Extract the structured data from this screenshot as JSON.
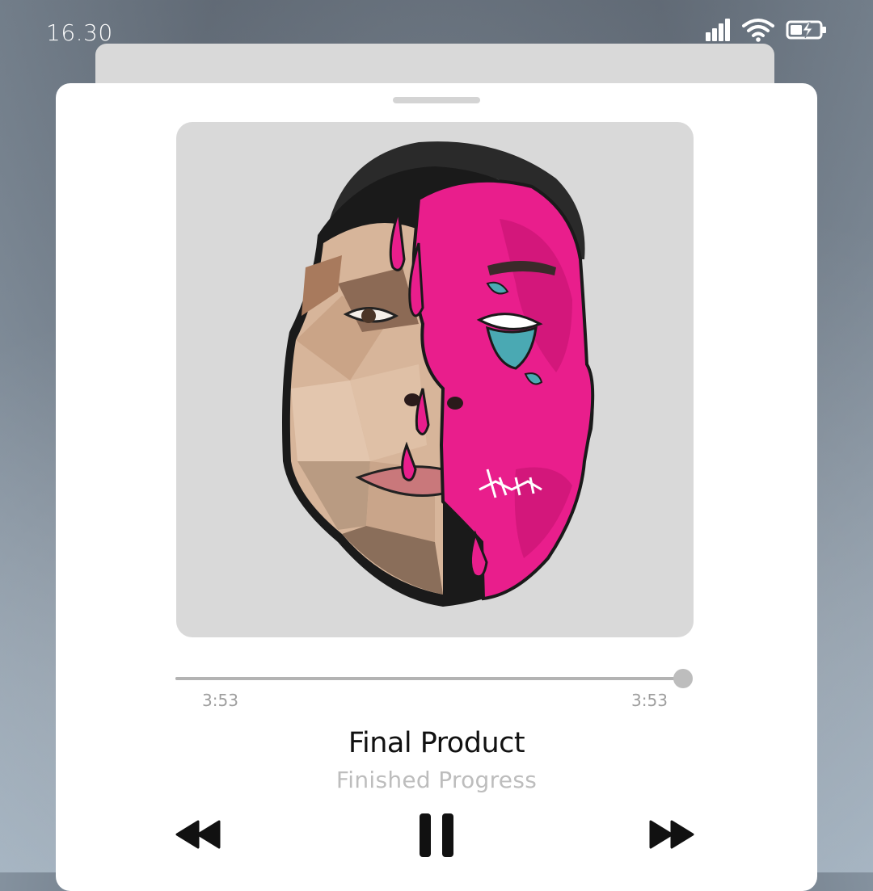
{
  "status_bar": {
    "time": "16.30",
    "icons": [
      "signal-bars-icon",
      "wifi-icon",
      "battery-charging-icon"
    ]
  },
  "player": {
    "album_art": "stylized face portrait with dripping pink paint",
    "progress": {
      "elapsed": "3:53",
      "total": "3:53",
      "fraction": 1.0
    },
    "title": "Final Product",
    "artist": "Finished Progress",
    "controls": [
      "rewind-icon",
      "pause-icon",
      "fast-forward-icon"
    ]
  },
  "colors": {
    "accent_pink": "#e91e8c",
    "skin": "#d9b8a0",
    "card": "#ffffff",
    "art_bg": "#d9d9d9",
    "subtitle": "#bdbdbd"
  }
}
